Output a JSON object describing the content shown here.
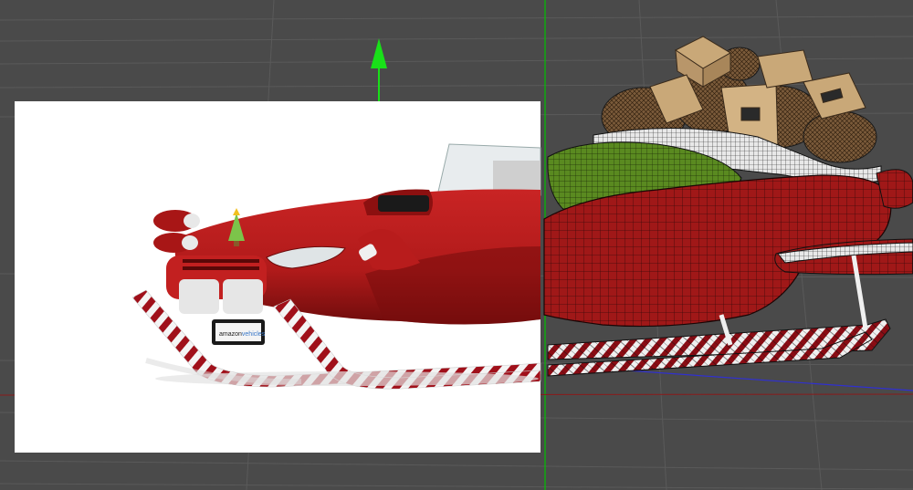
{
  "viewport": {
    "background_color": "#4a4a4a",
    "grid_color": "#5a5a5a",
    "y_axis_color": "#00c000",
    "x_axis_color": "#c00000",
    "z_axis_color": "#3030d0",
    "gizmo_color": "#19e019"
  },
  "render": {
    "background_color": "#ffffff",
    "body_color": "#b01a1a",
    "body_shadow_color": "#7a0e0e",
    "runner_stripe_color": "#a0101a",
    "license_plate": {
      "text_left": "amazon",
      "text_right": "vehicles",
      "right_color": "#3a78c8"
    }
  },
  "wireframe": {
    "body_color": "#a01818",
    "seat_color": "#5a8a20",
    "bag_color": "#7a5a3a",
    "box_color": "#c9a878",
    "line_color": "#1a1a1a"
  }
}
